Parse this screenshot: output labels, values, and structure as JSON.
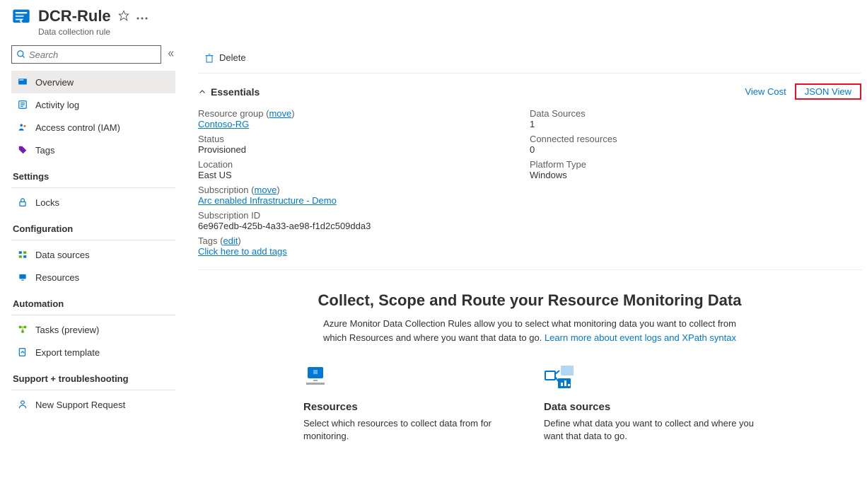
{
  "header": {
    "title": "DCR-Rule",
    "subtitle": "Data collection rule"
  },
  "search": {
    "placeholder": "Search"
  },
  "sidebar": {
    "top": [
      {
        "label": "Overview",
        "icon": "overview"
      },
      {
        "label": "Activity log",
        "icon": "log"
      },
      {
        "label": "Access control (IAM)",
        "icon": "iam"
      },
      {
        "label": "Tags",
        "icon": "tags"
      }
    ],
    "sections": [
      {
        "title": "Settings",
        "items": [
          {
            "label": "Locks",
            "icon": "lock"
          }
        ]
      },
      {
        "title": "Configuration",
        "items": [
          {
            "label": "Data sources",
            "icon": "datasrc"
          },
          {
            "label": "Resources",
            "icon": "resources"
          }
        ]
      },
      {
        "title": "Automation",
        "items": [
          {
            "label": "Tasks (preview)",
            "icon": "tasks"
          },
          {
            "label": "Export template",
            "icon": "export"
          }
        ]
      },
      {
        "title": "Support + troubleshooting",
        "items": [
          {
            "label": "New Support Request",
            "icon": "support"
          }
        ]
      }
    ]
  },
  "toolbar": {
    "delete": "Delete"
  },
  "essentials": {
    "label": "Essentials",
    "view_cost": "View Cost",
    "json_view": "JSON View",
    "left": {
      "resource_group_label": "Resource group",
      "move_label": "move",
      "resource_group_value": "Contoso-RG",
      "status_label": "Status",
      "status_value": "Provisioned",
      "location_label": "Location",
      "location_value": "East US",
      "subscription_label": "Subscription",
      "subscription_value": "Arc enabled Infrastructure - Demo",
      "subscription_id_label": "Subscription ID",
      "subscription_id_value": "6e967edb-425b-4a33-ae98-f1d2c509dda3",
      "tags_label": "Tags",
      "edit_label": "edit",
      "tags_value": "Click here to add tags"
    },
    "right": {
      "data_sources_label": "Data Sources",
      "data_sources_value": "1",
      "connected_label": "Connected resources",
      "connected_value": "0",
      "platform_label": "Platform Type",
      "platform_value": "Windows"
    }
  },
  "hero": {
    "title": "Collect, Scope and Route your Resource Monitoring Data",
    "desc_1": "Azure Monitor Data Collection Rules allow you to select what monitoring data you want to collect from which Resources and where you want that data to go. ",
    "desc_link": "Learn more about event logs and XPath syntax",
    "cards": [
      {
        "title": "Resources",
        "desc": "Select which resources to collect data from for monitoring."
      },
      {
        "title": "Data sources",
        "desc": "Define what data you want to collect and where you want that data to go."
      }
    ]
  }
}
